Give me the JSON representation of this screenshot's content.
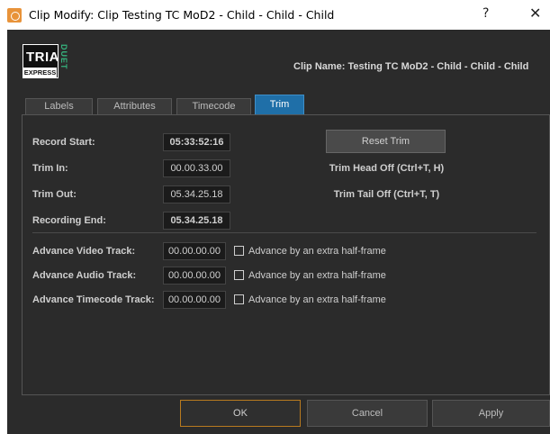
{
  "window": {
    "title": "Clip Modify: Clip Testing TC MoD2 - Child - Child - Child",
    "help_glyph": "?",
    "close_glyph": "✕"
  },
  "logo": {
    "tria": "TRIA",
    "express": "EXPRESS",
    "duet": "DUET"
  },
  "clip_name": "Clip Name: Testing TC MoD2 - Child - Child - Child",
  "tabs": [
    {
      "label": "Labels",
      "active": false
    },
    {
      "label": "Attributes",
      "active": false
    },
    {
      "label": "Timecode",
      "active": false
    },
    {
      "label": "Trim",
      "active": true
    }
  ],
  "trim": {
    "record_start": {
      "label": "Record Start:",
      "value": "05:33:52:16"
    },
    "trim_in": {
      "label": "Trim In:",
      "value": "00.00.33.00"
    },
    "trim_out": {
      "label": "Trim Out:",
      "value": "05.34.25.18"
    },
    "recording_end": {
      "label": "Recording End:",
      "value": "05.34.25.18"
    },
    "reset_trim": "Reset Trim",
    "trim_head_off": "Trim Head Off (Ctrl+T, H)",
    "trim_tail_off": "Trim Tail Off (Ctrl+T, T)"
  },
  "advance": {
    "video": {
      "label": "Advance Video Track:",
      "value": "00.00.00.00",
      "checkbox": "Advance by an extra half-frame",
      "checked": false
    },
    "audio": {
      "label": "Advance Audio Track:",
      "value": "00.00.00.00",
      "checkbox": "Advance by an extra half-frame",
      "checked": false
    },
    "timecode": {
      "label": "Advance Timecode Track:",
      "value": "00.00.00.00",
      "checkbox": "Advance by an extra half-frame",
      "checked": false
    }
  },
  "buttons": {
    "ok": "OK",
    "cancel": "Cancel",
    "apply": "Apply"
  },
  "colors": {
    "accent_tab": "#1f6fa8",
    "ok_border": "#b87a1f",
    "logo_green": "#36b37e",
    "app_icon": "#e8933a"
  }
}
